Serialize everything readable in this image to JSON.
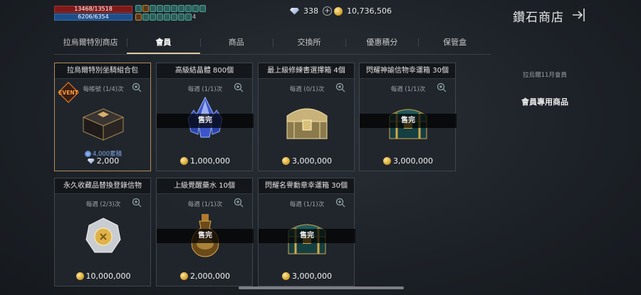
{
  "status": {
    "hp": "13468/13518",
    "mp": "6206/6354",
    "buff_count": "4"
  },
  "currency": {
    "gems": "338",
    "gold": "10,736,506"
  },
  "store_title": "鑽石商店",
  "tabs": [
    {
      "label": "拉烏爾特別商店"
    },
    {
      "label": "會員"
    },
    {
      "label": "商品"
    },
    {
      "label": "交換所"
    },
    {
      "label": "優惠積分"
    },
    {
      "label": "保管盒"
    }
  ],
  "side_panel": {
    "subtitle": "拉烏爾11月會員",
    "title": "會員專用商品"
  },
  "items": [
    {
      "name": "拉烏爾特別坐騎組合包",
      "limit": "每帳號 (1/4)次",
      "sold": "",
      "accum": "4,000累積",
      "price": "2,000",
      "currency": "gem",
      "badge": "EVENT"
    },
    {
      "name": "高級結晶體 800個",
      "limit": "每週 (1/1)次",
      "sold": "售完",
      "price": "1,000,000",
      "currency": "gold"
    },
    {
      "name": "最上級修練書選擇箱 4個",
      "limit": "每週 (0/1)次",
      "sold": "",
      "price": "3,000,000",
      "currency": "gold"
    },
    {
      "name": "閃耀神諭信物幸運箱 30個",
      "limit": "每週 (1/1)次",
      "sold": "售完",
      "price": "3,000,000",
      "currency": "gold"
    },
    {
      "name": "永久收藏品替換登錄信物",
      "limit": "每週 (2/3)次",
      "sold": "",
      "price": "10,000,000",
      "currency": "gold"
    },
    {
      "name": "上級覺醒藥水 10個",
      "limit": "每週 (1/1)次",
      "sold": "售完",
      "price": "2,000,000",
      "currency": "gold"
    },
    {
      "name": "閃耀名譽勳章幸運箱 30個",
      "limit": "每週 (1/1)次",
      "sold": "售完",
      "price": "3,000,000",
      "currency": "gold"
    }
  ],
  "colors": {
    "accent": "#d9c7a0",
    "selected_border": "#b08a58",
    "hp": "#7d1a18",
    "mp": "#1f4f8a"
  },
  "icons": [
    "gem-icon",
    "plus-icon",
    "coin-icon",
    "exit-icon",
    "zoom-icon"
  ]
}
